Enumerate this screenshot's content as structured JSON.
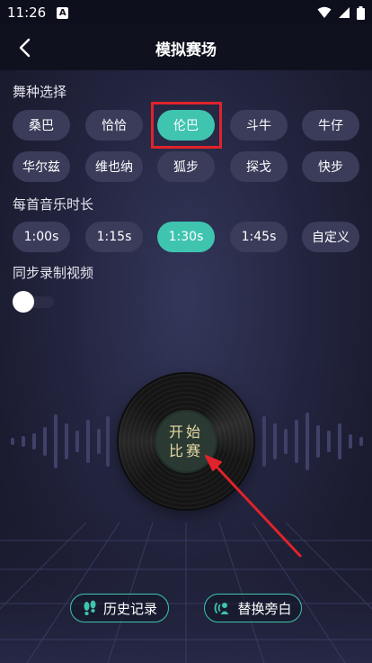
{
  "status_bar": {
    "time": "11:26",
    "notification_badge": "A"
  },
  "header": {
    "title": "模拟赛场",
    "back_icon": "chevron-left-icon"
  },
  "dance_section": {
    "label": "舞种选择",
    "selected": "伦巴",
    "options": [
      "桑巴",
      "恰恰",
      "伦巴",
      "斗牛",
      "牛仔",
      "华尔兹",
      "维也纳",
      "狐步",
      "探戈",
      "快步"
    ]
  },
  "duration_section": {
    "label": "每首音乐时长",
    "selected": "1:30s",
    "options": [
      "1:00s",
      "1:15s",
      "1:30s",
      "1:45s",
      "自定义"
    ]
  },
  "record_section": {
    "label": "同步录制视频",
    "enabled": false
  },
  "start_button": {
    "line1": "开始",
    "line2": "比赛"
  },
  "bottom_actions": {
    "history": {
      "label": "历史记录",
      "icon": "footprints-icon"
    },
    "narration": {
      "label": "替换旁白",
      "icon": "voice-wave-icon"
    }
  },
  "colors": {
    "accent": "#3fc4b0",
    "chip": "#3a3c5a",
    "highlight": "#e0232a",
    "gold_text": "#e8d9a4"
  }
}
